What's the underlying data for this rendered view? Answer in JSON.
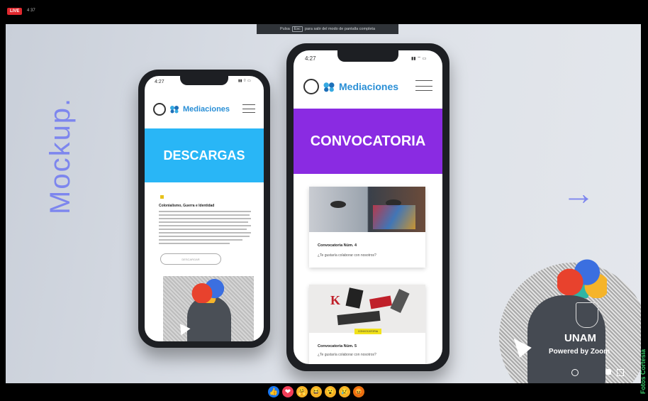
{
  "top_bar": {
    "live_label": "LIVE",
    "viewer_count": "4 37"
  },
  "fullscreen_tip": {
    "prefix": "Pulsa",
    "key": "Esc",
    "suffix": "para salir del modo de pantalla completa"
  },
  "slide": {
    "vertical_title": "Mockup.",
    "arrow_glyph": "→"
  },
  "phone_left": {
    "time": "4:27",
    "status_icons": "▮▮ ⌔ ▭",
    "logo_text": "Mediaciones",
    "banner_text": "DESCARGAS",
    "banner_color": "#29b6f6",
    "article_title": "Colonialismo, Guerra e Identidad",
    "button_label": "DESCARGAR"
  },
  "phone_right": {
    "time": "4:27",
    "status_icons": "▮▮ ⌔ ▭",
    "logo_text": "Mediaciones",
    "banner_text": "CONVOCATORIA",
    "banner_color": "#8a2be2",
    "card1_title": "Convocatoria Núm. 4",
    "card1_text": "¿Te gustaría colaborar con nosotros?",
    "card2_tag": "CONVOCATORIA",
    "card2_title": "Convocatoria Núm. 5",
    "card2_text": "¿Te gustaría colaborar con nosotros?"
  },
  "zoom_overlay": {
    "brand": "UNAM",
    "powered": "Powered by Zoom"
  },
  "reactions": [
    {
      "name": "like-reaction-icon",
      "color": "#1877f2",
      "glyph": "👍"
    },
    {
      "name": "love-reaction-icon",
      "color": "#f33e58",
      "glyph": "❤"
    },
    {
      "name": "care-reaction-icon",
      "color": "#f7b125",
      "glyph": "🤗"
    },
    {
      "name": "haha-reaction-icon",
      "color": "#f7b125",
      "glyph": "😆"
    },
    {
      "name": "wow-reaction-icon",
      "color": "#f7b125",
      "glyph": "😮"
    },
    {
      "name": "sad-reaction-icon",
      "color": "#f7b125",
      "glyph": "😢"
    },
    {
      "name": "angry-reaction-icon",
      "color": "#e9710f",
      "glyph": "😡"
    }
  ],
  "watermark": "Fotos Cortesía"
}
